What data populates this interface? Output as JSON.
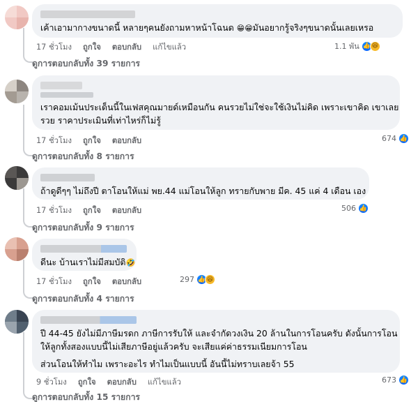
{
  "comments": [
    {
      "text_lines": [
        "เค้าเอามากางขนาดนี้ หลายๆคนยังถามหาหน้าโฉนด",
        "มันอยากรู้จริงๆขนาดนั้นเลยเหรอ"
      ],
      "time": "17 ชั่วโมง",
      "like": "ถูกใจ",
      "reply": "ตอบกลับ",
      "edited": "แก้ไขแล้ว",
      "reaction_count": "1.1 พัน",
      "replies": "ดูการตอบกลับทั้ง 39 รายการ"
    },
    {
      "text_lines": [
        "เราคอมเม้นประเด็นนี้ในเฟสคุณมายด์เหมือนกัน คนรวยไม่ใช่จะใช้เงินไม่คิด เพราะเขาคิด เขาเลย",
        "รวย ราคาประเมินที่เท่าไหร่ก็ไม่รู้"
      ],
      "time": "17 ชั่วโมง",
      "like": "ถูกใจ",
      "reply": "ตอบกลับ",
      "reaction_count": "674",
      "replies": "ดูการตอบกลับทั้ง 8 รายการ"
    },
    {
      "text_lines": [
        "ถ้าดูดีๆๆ ไม่ถึงปี ตาโอนให้แม่ พย.44 แม่โอนให้ลูก ทรายกับพาย มีค. 45 แค่ 4 เดือน เอง"
      ],
      "time": "17 ชั่วโมง",
      "like": "ถูกใจ",
      "reply": "ตอบกลับ",
      "reaction_count": "506",
      "replies": "ดูการตอบกลับทั้ง 9 รายการ"
    },
    {
      "text_lines": [
        "ดีนะ บ้านเราไม่มีสมบัติ"
      ],
      "time": "17 ชั่วโมง",
      "like": "ถูกใจ",
      "reply": "ตอบกลับ",
      "reaction_count": "297",
      "replies": "ดูการตอบกลับทั้ง 4 รายการ"
    },
    {
      "text_lines": [
        "ปี 44-45 ยังไม่มีภาษีมรดก ภาษีการรับให้ และจำกัดวงเงิน 20 ล้านในการโอนครับ ดังนั้นการโอน",
        "ให้ลูกทั้งสองแบบนี้ไม่เสียภาษีอยู่แล้วครับ จะเสียแค่ค่าธรรมเนียมการโอน",
        "ส่วนโอนให้ทำไม เพราะอะไร ทำไมเป็นแบบนี้ อันนี้ไม่ทราบเลยจ้า 55"
      ],
      "time": "9 ชั่วโมง",
      "like": "ถูกใจ",
      "reply": "ตอบกลับ",
      "edited": "แก้ไขแล้ว",
      "reaction_count": "673",
      "replies": "ดูการตอบกลับทั้ง 15 รายการ"
    }
  ],
  "icons": {
    "like": "thumbs-up-icon",
    "laugh": "laugh-icon",
    "grin": "grinning-face-icon",
    "rofl": "rolling-laughing-icon"
  },
  "colors": {
    "bubble": "#f0f2f5",
    "meta_text": "#65676b",
    "like_blue": "#0866ff",
    "laugh_yellow": "#f7b928"
  }
}
